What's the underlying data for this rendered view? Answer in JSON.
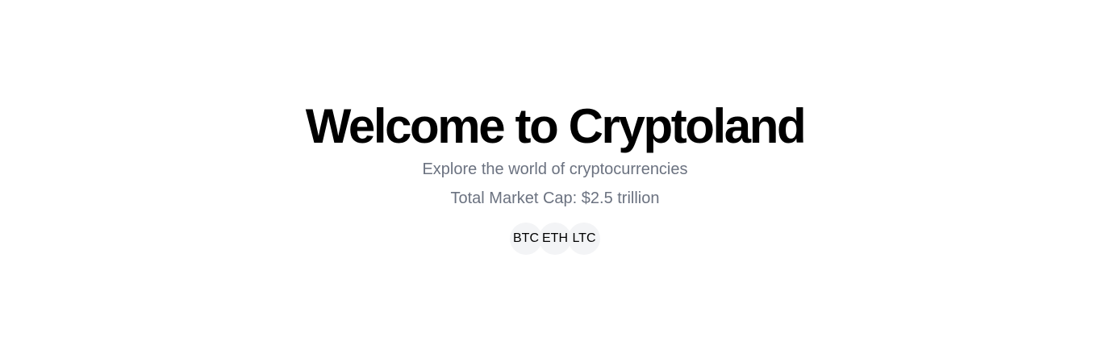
{
  "hero": {
    "title": "Welcome to Cryptoland",
    "subtitle": "Explore the world of cryptocurrencies",
    "market_cap": "Total Market Cap: $2.5 trillion"
  },
  "coins": [
    {
      "symbol": "BTC"
    },
    {
      "symbol": "ETH"
    },
    {
      "symbol": "LTC"
    }
  ],
  "colors": {
    "background": "#ffffff",
    "title": "#000000",
    "muted_text": "#6b7280",
    "coin_bg": "#f3f4f6"
  }
}
